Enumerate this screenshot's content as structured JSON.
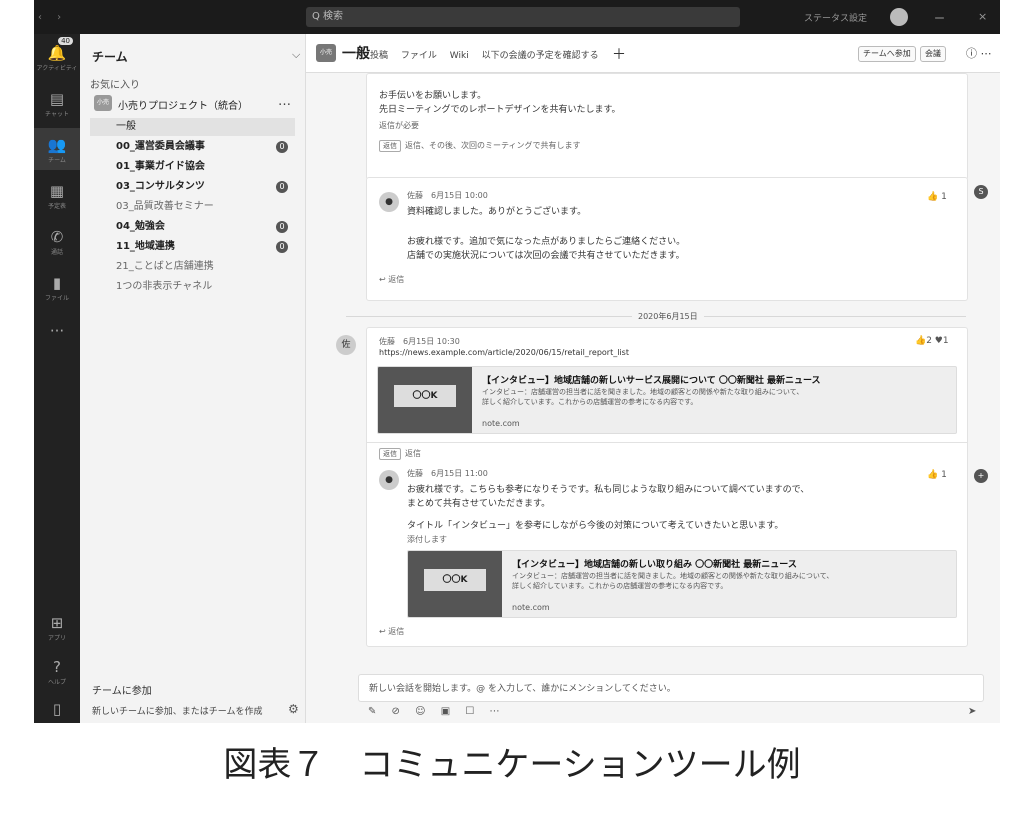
{
  "window": {
    "search_placeholder": "Q 検索",
    "status_text": "ステータス設定",
    "win_min": "ー",
    "win_close": "×"
  },
  "appbar": [
    {
      "icon": "activity-icon",
      "glyph": "🔔",
      "label": "アクティビティ",
      "badge": "40"
    },
    {
      "icon": "chat-icon",
      "glyph": "▤",
      "label": "チャット"
    },
    {
      "icon": "teams-icon",
      "glyph": "👥",
      "label": "チーム",
      "active": true
    },
    {
      "icon": "calendar-icon",
      "glyph": "▦",
      "label": "予定表"
    },
    {
      "icon": "calls-icon",
      "glyph": "✆",
      "label": "通話"
    },
    {
      "icon": "files-icon",
      "glyph": "▮",
      "label": "ファイル"
    },
    {
      "icon": "more-icon",
      "glyph": "···",
      "label": ""
    }
  ],
  "appbar_bottom": [
    {
      "icon": "apps-icon",
      "glyph": "⊞",
      "label": "アプリ"
    },
    {
      "icon": "help-icon",
      "glyph": "?",
      "label": "ヘルプ"
    },
    {
      "icon": "device-icon",
      "glyph": "▯",
      "label": ""
    }
  ],
  "leftpanel": {
    "title": "チーム",
    "section": "お気に入り",
    "team_name": "小売りプロジェクト（統合）",
    "team_avatar": "小売",
    "more": "…",
    "channels": [
      {
        "name": "一般",
        "active": true,
        "bold": false,
        "badge": ""
      },
      {
        "name": "00_運営委員会議事",
        "bold": true,
        "badge": "0"
      },
      {
        "name": "01_事業ガイド協会",
        "bold": true,
        "badge": ""
      },
      {
        "name": "03_コンサルタンツ",
        "bold": true,
        "badge": "0"
      },
      {
        "name": "03_品質改善セミナー",
        "bold": false,
        "grey": true,
        "badge": ""
      },
      {
        "name": "04_勉強会",
        "bold": true,
        "badge": "0"
      },
      {
        "name": "11_地域連携",
        "bold": true,
        "badge": "0"
      },
      {
        "name": "21_ことばと店舗連携",
        "bold": false,
        "grey": true,
        "badge": ""
      },
      {
        "name": "1つの非表示チャネル",
        "bold": false,
        "grey": true,
        "badge": ""
      }
    ],
    "join_text": "チームに参加",
    "hint_text": "新しいチームに参加、またはチームを作成",
    "gear": "⚙"
  },
  "channel_header": {
    "avatar": "小売",
    "name": "一般",
    "tabs": [
      "投稿",
      "ファイル",
      "Wiki",
      "以下の会議の予定を確認する"
    ],
    "add": "＋",
    "btn_join": "チームへ参加",
    "btn_meet": "会議",
    "icons": "ⓘ ⋯"
  },
  "feed": {
    "top_card": {
      "line1": "お手伝いをお願いします。",
      "line2": "先日ミーティングでのレポートデザインを共有いたします。",
      "line3": "返信が必要",
      "reply_bar": "返信、その後、次回のミーティングで共有します"
    },
    "reply1": {
      "tag": "返信",
      "author": "佐藤　6月15日 10:00",
      "text1": "資料確認しました。ありがとうございます。",
      "text2": "お疲れ様です。追加で気になった点がありましたらご連絡ください。",
      "text3": "店舗での実施状況については次回の会議で共有させていただきます。",
      "likes": "👍 1",
      "reply_link": "↩ 返信",
      "side": "S"
    },
    "date_divider": "2020年6月15日",
    "post2": {
      "avatar": "佐",
      "author": "佐藤　6月15日 10:30",
      "url": "https://news.example.com/article/2020/06/15/retail_report_list",
      "reactions": "👍2 ♥1",
      "link_title": "【インタビュー】地域店舗の新しいサービス展開について 〇〇新聞社 最新ニュース",
      "link_desc1": "インタビュー：店舗運営の担当者に話を聞きました。地域の顧客との関係や新たな取り組みについて、",
      "link_desc2": "詳しく紹介しています。これからの店舗運営の参考になる内容です。",
      "link_domain": "note.com",
      "sign": "〇〇K"
    },
    "reply2": {
      "tag": "返信",
      "reply_bar": "返信",
      "author": "佐藤　6月15日 11:00",
      "text1": "お疲れ様です。こちらも参考になりそうです。私も同じような取り組みについて調べていますので、",
      "text2": "まとめて共有させていただきます。",
      "text3": "タイトル「インタビュー」を参考にしながら今後の対策について考えていきたいと思います。",
      "text4": "添付します",
      "likes": "👍 1",
      "link_title": "【インタビュー】地域店舗の新しい取り組み 〇〇新聞社 最新ニュース",
      "link_desc1": "インタビュー：店舗運営の担当者に話を聞きました。地域の顧客との関係や新たな取り組みについて、",
      "link_desc2": "詳しく紹介しています。これからの店舗運営の参考になる内容です。",
      "link_domain": "note.com",
      "reply_link": "↩ 返信",
      "side": "+",
      "sign": "〇〇K"
    }
  },
  "composer": {
    "placeholder": "新しい会話を開始します。@ を入力して、誰かにメンションしてください。",
    "tools": "✎ ⊘ ☺ ▣ ☐ ⋯",
    "send": "➤"
  },
  "caption": "図表７　コミュニケーションツール例"
}
